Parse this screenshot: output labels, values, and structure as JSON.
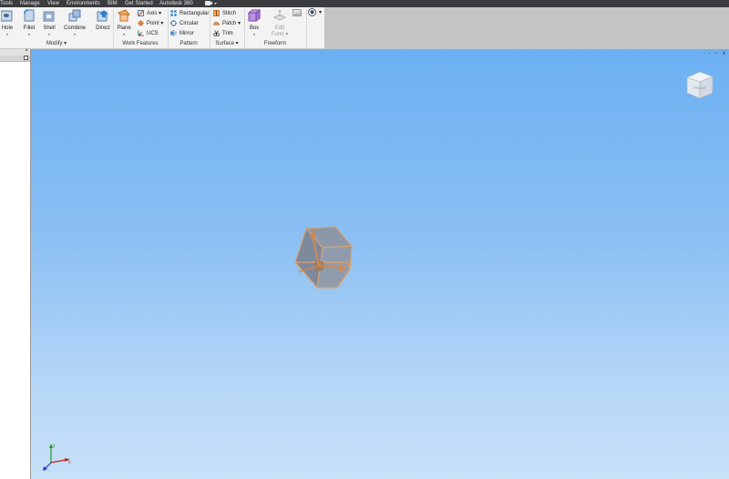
{
  "menu": [
    "Tools",
    "Manage",
    "View",
    "Environments",
    "BIM",
    "Get Started",
    "Autodesk 360"
  ],
  "modify_panel": {
    "title": "Modify",
    "buttons": [
      "Hole",
      "Fillet",
      "Shell",
      "Combine",
      "Direct"
    ]
  },
  "work_features_panel": {
    "title": "Work Features",
    "plane_label": "Plane",
    "items": [
      "Axis",
      "Point",
      "UCS"
    ]
  },
  "pattern_panel": {
    "title": "Pattern",
    "items": [
      "Rectangular",
      "Circular",
      "Mirror"
    ]
  },
  "surface_panel": {
    "title": "Surface",
    "items": [
      "Stitch",
      "Patch",
      "Trim"
    ]
  },
  "freeform_panel": {
    "title": "Freeform",
    "box_label": "Box",
    "edit_form_line1": "Edit",
    "edit_form_line2": "Form"
  },
  "viewcube_face": "FRONT",
  "window_controls": "- ▫ x",
  "colors": {
    "menubar": "#3b3c3e",
    "ribbon": "#f3f3f3",
    "viewport_top": "#6cb0f2",
    "viewport_bottom": "#c8e0f8",
    "cube_face": "#8a96a6",
    "cube_edge": "#e09a60"
  },
  "icons": [
    "hole-icon",
    "fillet-icon",
    "shell-icon",
    "combine-icon",
    "direct-icon",
    "plane-icon",
    "axis-icon",
    "point-icon",
    "ucs-icon",
    "rectangular-pattern-icon",
    "circular-pattern-icon",
    "mirror-icon",
    "stitch-icon",
    "patch-icon",
    "trim-icon",
    "box-icon",
    "edit-form-icon"
  ]
}
